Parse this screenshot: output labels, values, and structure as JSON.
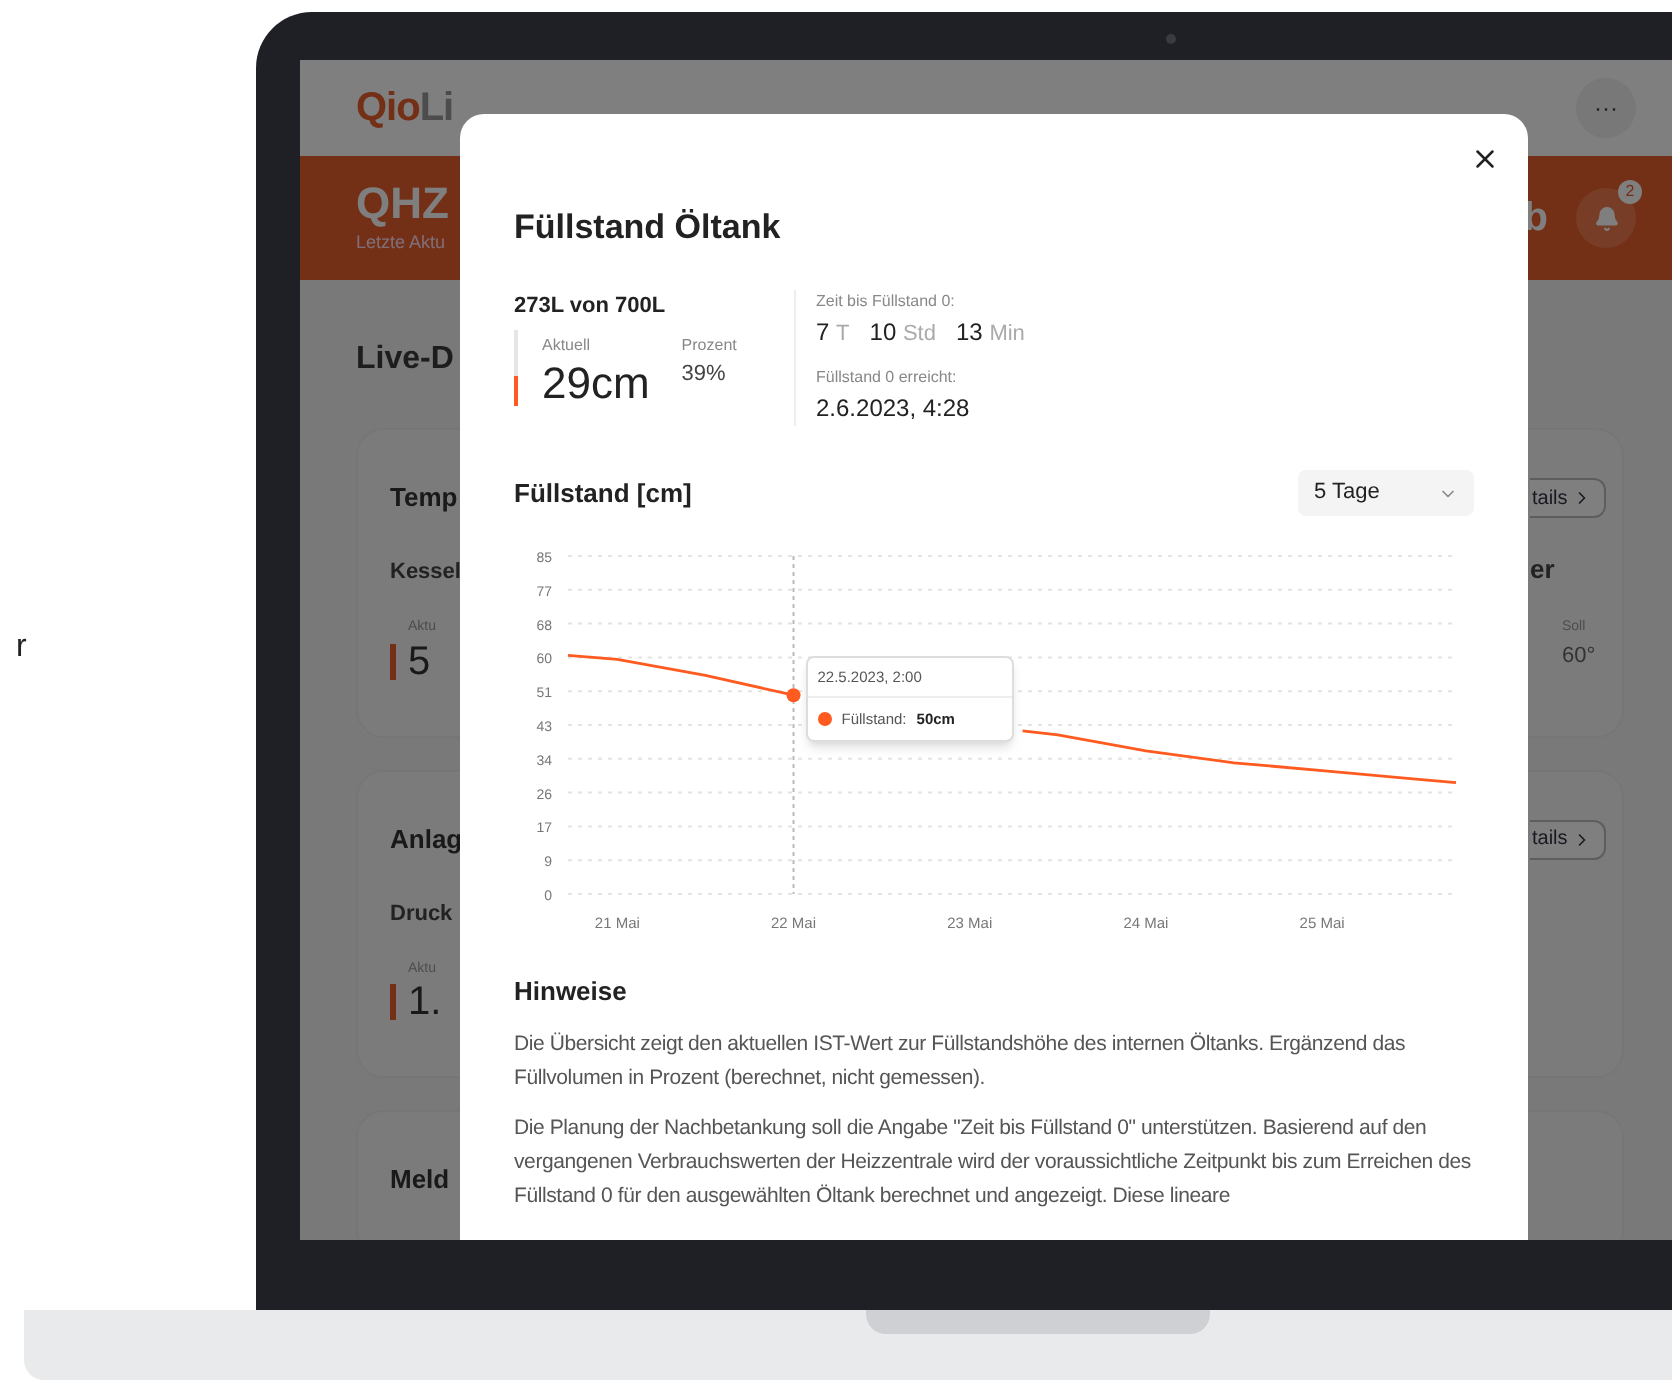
{
  "stray_text": "r",
  "app": {
    "logo": {
      "accent": "Qio",
      "rest": "Li"
    },
    "menu_button": "···",
    "banner": {
      "title": "QHZ",
      "subtitle": "Letzte Aktu",
      "right_text": "b",
      "notification_count": "2"
    },
    "section_title": "Live-D",
    "cards": [
      {
        "title": "Temp",
        "detail_button": "tails",
        "row_label": "Kessel",
        "value_label": "Aktu",
        "value": "5",
        "right_label": "er",
        "right_value_label": "Soll",
        "right_value": "60°"
      },
      {
        "title": "Anlag",
        "detail_button": "tails",
        "row_label": "Druck",
        "value_label": "Aktu",
        "value": "1."
      },
      {
        "title": "Meld"
      }
    ]
  },
  "dialog": {
    "title": "Füllstand Öltank",
    "volume": "273L von 700L",
    "gauge": {
      "level": 0.39
    },
    "current": {
      "label": "Aktuell",
      "value": "29cm"
    },
    "percent": {
      "label": "Prozent",
      "value": "39%"
    },
    "time_to_empty": {
      "label": "Zeit bis Füllstand 0:",
      "parts": [
        {
          "number": "7",
          "unit": "T"
        },
        {
          "number": "10",
          "unit": "Std"
        },
        {
          "number": "13",
          "unit": "Min"
        }
      ]
    },
    "empty_at": {
      "label": "Füllstand 0 erreicht:",
      "value": "2.6.2023, 4:28"
    },
    "chart": {
      "title": "Füllstand [cm]",
      "range_select": {
        "value": "5 Tage"
      },
      "chart_data": {
        "type": "line",
        "x": [
          20.72,
          21,
          21.5,
          22,
          22.5,
          23,
          23.3,
          23.5,
          24,
          24.5,
          25,
          25.5,
          25.76
        ],
        "series": [
          {
            "name": "Füllstand",
            "color": "#ff5a1f",
            "values": [
              60,
              59,
              55,
              50,
              null,
              null,
              41,
              40,
              36,
              33,
              31,
              29,
              28
            ]
          }
        ],
        "grid": true,
        "xlim": [
          20.72,
          25.76
        ],
        "ylim": [
          0,
          85
        ],
        "xticks": [
          {
            "value": 21,
            "label": "21 Mai"
          },
          {
            "value": 22,
            "label": "22 Mai"
          },
          {
            "value": 23,
            "label": "23 Mai"
          },
          {
            "value": 24,
            "label": "24 Mai"
          },
          {
            "value": 25,
            "label": "25 Mai"
          }
        ],
        "yticks": [
          {
            "value": 0,
            "label": "0"
          },
          {
            "value": 8.5,
            "label": "9"
          },
          {
            "value": 17,
            "label": "17"
          },
          {
            "value": 25.5,
            "label": "26"
          },
          {
            "value": 34,
            "label": "34"
          },
          {
            "value": 42.5,
            "label": "43"
          },
          {
            "value": 51,
            "label": "51"
          },
          {
            "value": 59.5,
            "label": "60"
          },
          {
            "value": 68,
            "label": "68"
          },
          {
            "value": 76.5,
            "label": "77"
          },
          {
            "value": 85,
            "label": "85"
          }
        ],
        "ref_lines": [
          {
            "axis": "x",
            "value": 22
          }
        ]
      },
      "tooltip": {
        "date": "22.5.2023, 2:00",
        "separator": ":",
        "value": "50cm"
      }
    },
    "notes": {
      "title": "Hinweise",
      "paragraphs": [
        "Die Übersicht zeigt den aktuellen IST-Wert zur Füllstandshöhe des internen Öltanks. Ergänzend das Füllvolumen in Prozent (berechnet, nicht gemessen).",
        "Die Planung der Nachbetankung soll die Angabe \"Zeit bis Füllstand 0\" unterstützen. Basierend auf den vergangenen Verbrauchswerten der Heizzentrale wird der voraussichtliche Zeitpunkt bis zum Erreichen des Füllstand 0 für den ausgewählten Öltank berechnet und angezeigt. Diese lineare"
      ]
    }
  }
}
